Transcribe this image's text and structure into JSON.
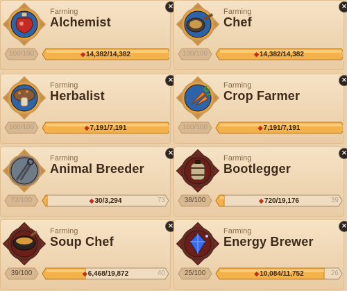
{
  "cards": [
    {
      "category": "Farming",
      "name": "Alchemist",
      "level": "100/100",
      "xp": "14,382/14,382",
      "progress": 1.0,
      "next": "",
      "icon": "potion-icon",
      "ring": "#e6a03c",
      "bg": "#2d63a8",
      "dark": false
    },
    {
      "category": "Farming",
      "name": "Chef",
      "level": "100/100",
      "xp": "14,382/14,382",
      "progress": 1.0,
      "next": "",
      "icon": "frying-pan-icon",
      "ring": "#e6a03c",
      "bg": "#2d63a8",
      "dark": false
    },
    {
      "category": "Farming",
      "name": "Herbalist",
      "level": "100/100",
      "xp": "7,191/7,191",
      "progress": 1.0,
      "next": "",
      "icon": "mushroom-icon",
      "ring": "#e6a03c",
      "bg": "#2d63a8",
      "dark": false
    },
    {
      "category": "Farming",
      "name": "Crop Farmer",
      "level": "100/100",
      "xp": "7,191/7,191",
      "progress": 1.0,
      "next": "",
      "icon": "carrot-icon",
      "ring": "#e6a03c",
      "bg": "#2d63a8",
      "dark": false
    },
    {
      "category": "Farming",
      "name": "Animal Breeder",
      "level": "72/100",
      "xp": "30/3,294",
      "progress": 0.01,
      "next": "73",
      "icon": "shears-icon",
      "ring": "#8a7a70",
      "bg": "#6e7c88",
      "dark": false,
      "locked": true
    },
    {
      "category": "Farming",
      "name": "Bootlegger",
      "level": "38/100",
      "xp": "720/19,176",
      "progress": 0.0375,
      "next": "39",
      "icon": "barrel-icon",
      "ring": "#6a2a24",
      "bg": "#6b1f18",
      "dark": true
    },
    {
      "category": "Farming",
      "name": "Soup Chef",
      "level": "39/100",
      "xp": "6,468/19,872",
      "progress": 0.3255,
      "next": "40",
      "icon": "cauldron-icon",
      "ring": "#6a2a24",
      "bg": "#6b1f18",
      "dark": true
    },
    {
      "category": "Farming",
      "name": "Energy Brewer",
      "level": "25/100",
      "xp": "10,084/11,752",
      "progress": 0.858,
      "next": "26",
      "icon": "crystal-icon",
      "ring": "#6a2a24",
      "bg": "#6b1f18",
      "dark": true
    }
  ],
  "close_glyph": "×"
}
